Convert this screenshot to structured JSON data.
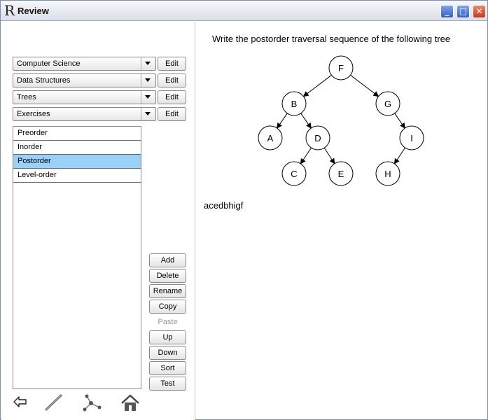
{
  "window": {
    "title": "Review",
    "app_icon_glyph": "R"
  },
  "window_controls": {
    "minimize": "_",
    "maximize": "□",
    "close": "✕"
  },
  "selectors": [
    {
      "value": "Computer Science",
      "edit_label": "Edit"
    },
    {
      "value": "Data Structures",
      "edit_label": "Edit"
    },
    {
      "value": "Trees",
      "edit_label": "Edit"
    },
    {
      "value": "Exercises",
      "edit_label": "Edit"
    }
  ],
  "items": [
    {
      "label": "Preorder",
      "selected": false
    },
    {
      "label": "Inorder",
      "selected": false
    },
    {
      "label": "Postorder",
      "selected": true
    },
    {
      "label": "Level-order",
      "selected": false
    }
  ],
  "actions": [
    {
      "label": "Add",
      "enabled": true
    },
    {
      "label": "Delete",
      "enabled": true
    },
    {
      "label": "Rename",
      "enabled": true
    },
    {
      "label": "Copy",
      "enabled": true
    },
    {
      "label": "Paste",
      "enabled": false
    },
    {
      "label": "Up",
      "enabled": true
    },
    {
      "label": "Down",
      "enabled": true
    },
    {
      "label": "Sort",
      "enabled": true
    },
    {
      "label": "Test",
      "enabled": true
    }
  ],
  "bottom_toolbar": [
    "back-arrow-icon",
    "pencil-icon",
    "graph-icon",
    "home-icon"
  ],
  "content": {
    "question": "Write the postorder traversal sequence of the following tree",
    "answer": "acedbhigf"
  },
  "tree": {
    "nodes": [
      "F",
      "B",
      "G",
      "A",
      "D",
      "I",
      "C",
      "E",
      "H"
    ]
  },
  "colors": {
    "selection": "#99d1f9",
    "close_button": "#c8391a",
    "title_buttons": "#3160c9"
  }
}
